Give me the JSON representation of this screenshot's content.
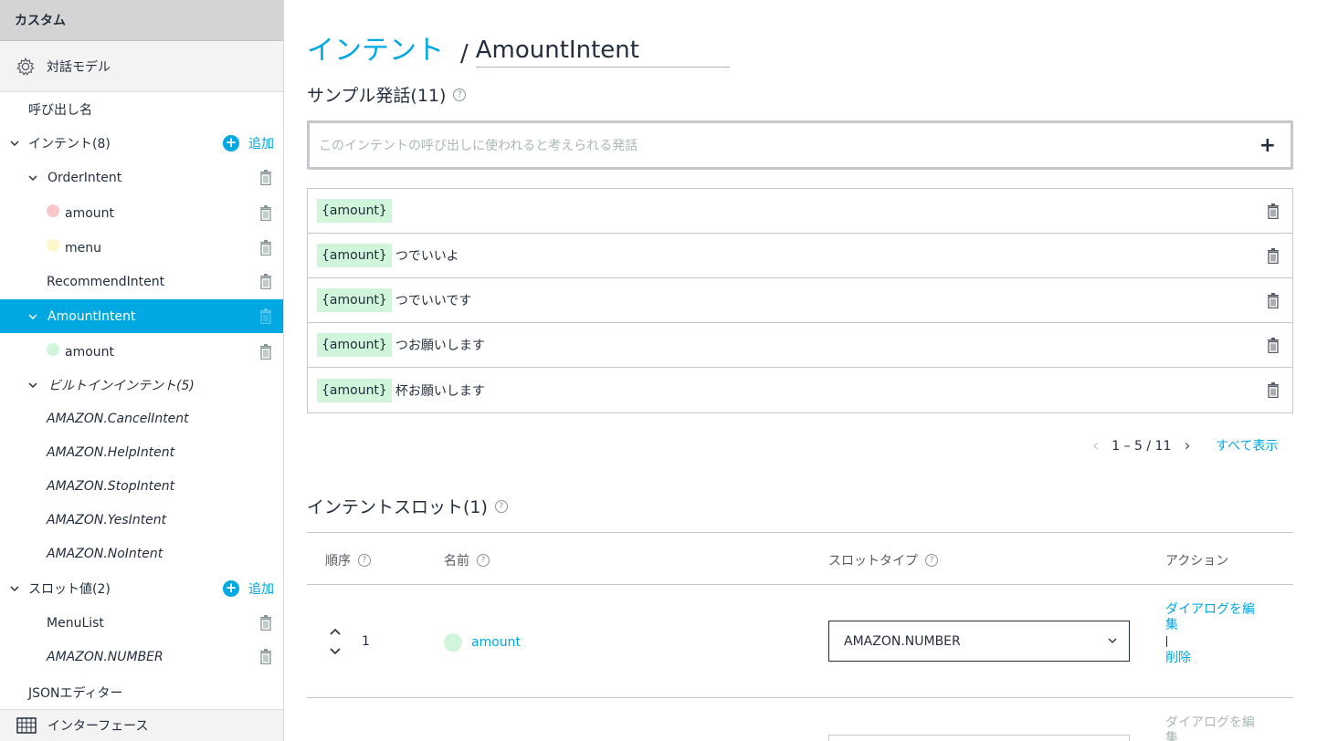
{
  "sidebar": {
    "header": "カスタム",
    "model_label": "対話モデル",
    "invocation_label": "呼び出し名",
    "intents_label": "インテント(8)",
    "add_label": "追加",
    "items": [
      {
        "label": "OrderIntent"
      },
      {
        "label": "amount",
        "dot_color": "#f9c7c7"
      },
      {
        "label": "menu",
        "dot_color": "#fcf6c8"
      },
      {
        "label": "RecommendIntent"
      },
      {
        "label": "AmountIntent"
      },
      {
        "label": "amount",
        "dot_color": "#d0f5da"
      }
    ],
    "builtin_label": "ビルトインインテント(5)",
    "builtin_items": [
      "AMAZON.CancelIntent",
      "AMAZON.HelpIntent",
      "AMAZON.StopIntent",
      "AMAZON.YesIntent",
      "AMAZON.NoIntent"
    ],
    "slot_types_label": "スロット値(2)",
    "slot_types": [
      "MenuList",
      "AMAZON.NUMBER"
    ],
    "json_editor_label": "JSONエディター",
    "footer_label": "インターフェース",
    "active_color": "#00a8e1"
  },
  "main": {
    "breadcrumb_link": "インテント",
    "breadcrumb_sep": "/",
    "intent_name": "AmountIntent",
    "utterances_title": "サンプル発話(11)",
    "utterance_placeholder": "このインテントの呼び出しに使われると考えられる発話",
    "add_symbol": "+",
    "utterances": [
      {
        "slot": "{amount}",
        "text": ""
      },
      {
        "slot": "{amount}",
        "text": "つでいいよ"
      },
      {
        "slot": "{amount}",
        "text": "つでいいです"
      },
      {
        "slot": "{amount}",
        "text": "つお願いします"
      },
      {
        "slot": "{amount}",
        "text": "杯お願いします"
      }
    ],
    "pager": {
      "prev": "‹",
      "count": "1 – 5 / 11",
      "next": "›",
      "show_all": "すべて表示"
    },
    "slots_title": "インテントスロット(1)",
    "slot_columns": {
      "order": "順序",
      "name": "名前",
      "type": "スロットタイプ",
      "action": "アクション"
    },
    "slots": [
      {
        "order": "1",
        "name": "amount",
        "type": "AMAZON.NUMBER",
        "edit": "ダイアログを編集",
        "delete": "削除"
      }
    ],
    "ghost_row": {
      "edit": "ダイアログを編集"
    },
    "help_symbol": "?"
  }
}
